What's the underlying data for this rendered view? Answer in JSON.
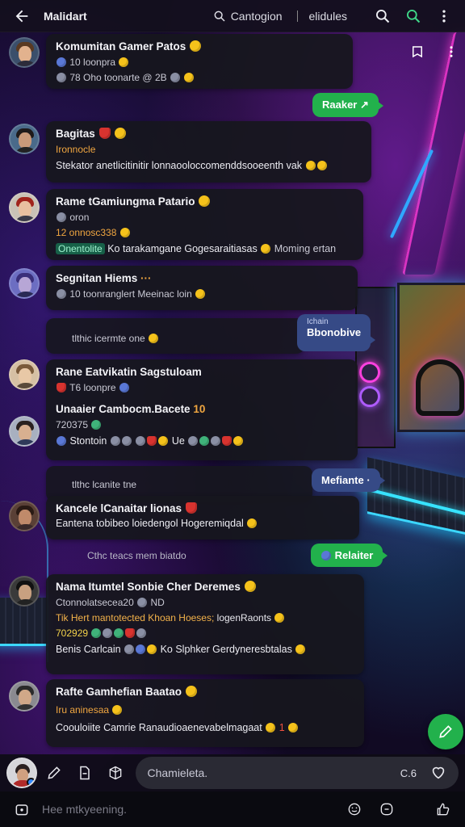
{
  "appbar": {
    "title": "Malidart",
    "search_label": "Cantogion",
    "filter_label": "elidules",
    "icons": [
      "back-arrow-icon",
      "search-icon",
      "search-green-icon",
      "more-vertical-icon"
    ]
  },
  "colors": {
    "accent_green": "#22b14c",
    "bubble_blue": "#364a86",
    "card_bg": "#16161e",
    "subtitle_orange": "#f0a640"
  },
  "chats": [
    {
      "name": "Komumitan Gamer Patos",
      "line1": "10 loonpra",
      "line2": "78 Oho toonarte",
      "line2_tail": "@ 2B"
    },
    {
      "name": "Bagitas",
      "line1": "Ironnocle",
      "line2": "Stekator anetlicitinitir lonnaooloccomenddsooeenth vak"
    },
    {
      "name": "Rame tGamiungma Patario",
      "line1": "oron",
      "line1b": "12 onnosc338",
      "badge": "Onentolite",
      "line2": "Ko tarakamgane Gogesaraitiasas",
      "line2_tail": "Moming ertan"
    },
    {
      "name": "Segnitan Hiems",
      "line1": "10 toonranglert Meeinac loin"
    },
    {
      "sys": "tlthic icermte one"
    },
    {
      "name": "Rane Eatvikatin Sagstuloam",
      "line1": "T6 loonpre"
    },
    {
      "name": "Unaaier Cambocm.Bacete",
      "name_tail": "10",
      "line1": "720375",
      "line2": "Stontoin",
      "line2_tail": "Ue"
    },
    {
      "sys": "tlthc lcanite tne"
    },
    {
      "name": "Kancele lCanaitar lionas",
      "line1": "Eantena tobibeo loiedengol Hogeremiqdal"
    },
    {
      "name": "Nama Itumtel Sonbie Cher Deremes",
      "line1": "Ctonnolatsecea20",
      "line1_tail": "ND",
      "line2": "Tik Hert mantotected Khoan Hoeses;",
      "line2_tail": "logenRaonts",
      "line3": "702929",
      "line4": "Benis Carlcain",
      "line4_tail": "Ko Slphker Gerdyneresbtalas"
    },
    {
      "name": "Rafte Gamhefian Baatao",
      "line1": "Iru aninesaa",
      "line2": "Coouloiite Camrie Ranaudioaenevabelmagaat",
      "line2_tail": "1"
    }
  ],
  "bubbles": {
    "b1": "Raaker",
    "b2_small": "Ichain",
    "b2": "Bbonobive",
    "b3": "Mefiante",
    "b4": "Relaiter"
  },
  "system_lines": {
    "s1": "Cthc teacs mem biatdo"
  },
  "composer": {
    "placeholder": "Chamieleta.",
    "counter": "C.6"
  },
  "bottombar": {
    "hint": "Hee mtkyeening."
  }
}
